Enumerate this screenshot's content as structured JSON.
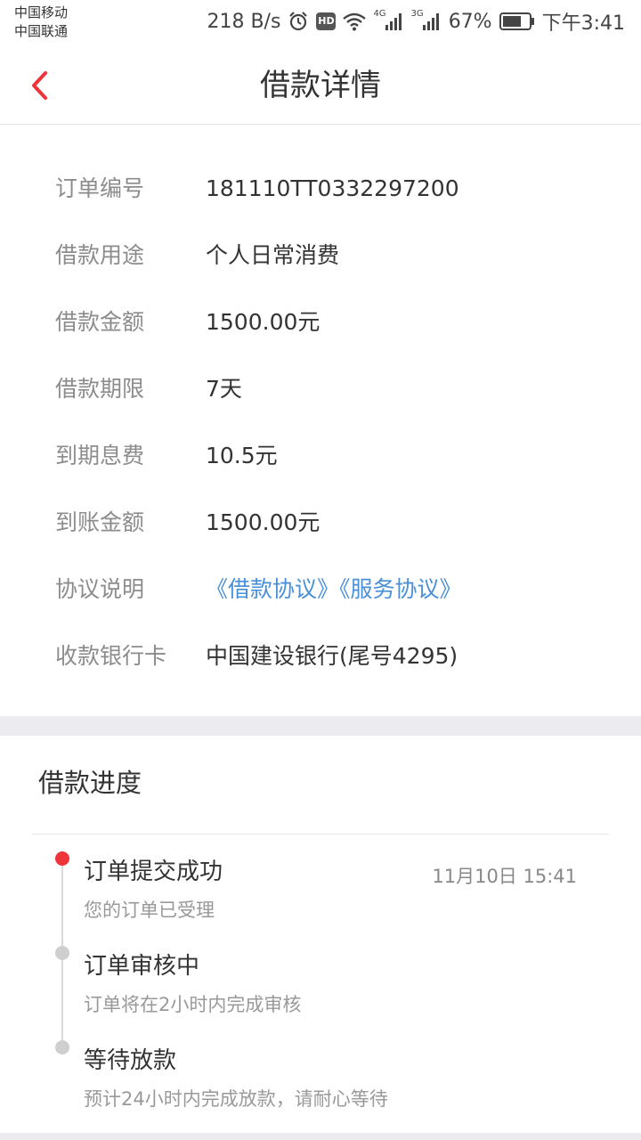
{
  "status_bar": {
    "carrier_1": "中国移动",
    "carrier_2": "中国联通",
    "net_speed": "218 B/s",
    "hd_label": "HD",
    "net_4g": "4G",
    "net_3g": "3G",
    "battery": "67%",
    "time": "下午3:41",
    "icons": [
      "alarm-icon",
      "hd-icon",
      "wifi-icon",
      "signal-4g-icon",
      "signal-3g-icon",
      "battery-icon"
    ]
  },
  "header": {
    "title": "借款详情",
    "back_icon": "chevron-left-icon",
    "accent_color": "#f0343b"
  },
  "details": [
    {
      "label": "订单编号",
      "value": "181110TT0332297200"
    },
    {
      "label": "借款用途",
      "value": "个人日常消费"
    },
    {
      "label": "借款金额",
      "value": "1500.00元"
    },
    {
      "label": "借款期限",
      "value": "7天"
    },
    {
      "label": "到期息费",
      "value": "10.5元"
    },
    {
      "label": "到账金额",
      "value": "1500.00元"
    },
    {
      "label": "协议说明",
      "links": [
        "《借款协议》",
        "《服务协议》"
      ],
      "link_color": "#4a90d9"
    },
    {
      "label": "收款银行卡",
      "value": "中国建设银行(尾号4295)"
    }
  ],
  "progress": {
    "title": "借款进度",
    "steps": [
      {
        "title": "订单提交成功",
        "desc": "您的订单已受理",
        "time": "11月10日 15:41",
        "status": "done",
        "dot_color": "#f0343b"
      },
      {
        "title": "订单审核中",
        "desc": "订单将在2小时内完成审核",
        "status": "pending",
        "dot_color": "#cfcfcf"
      },
      {
        "title": "等待放款",
        "desc": "预计24小时内完成放款，请耐心等待",
        "status": "pending",
        "dot_color": "#cfcfcf"
      }
    ]
  }
}
